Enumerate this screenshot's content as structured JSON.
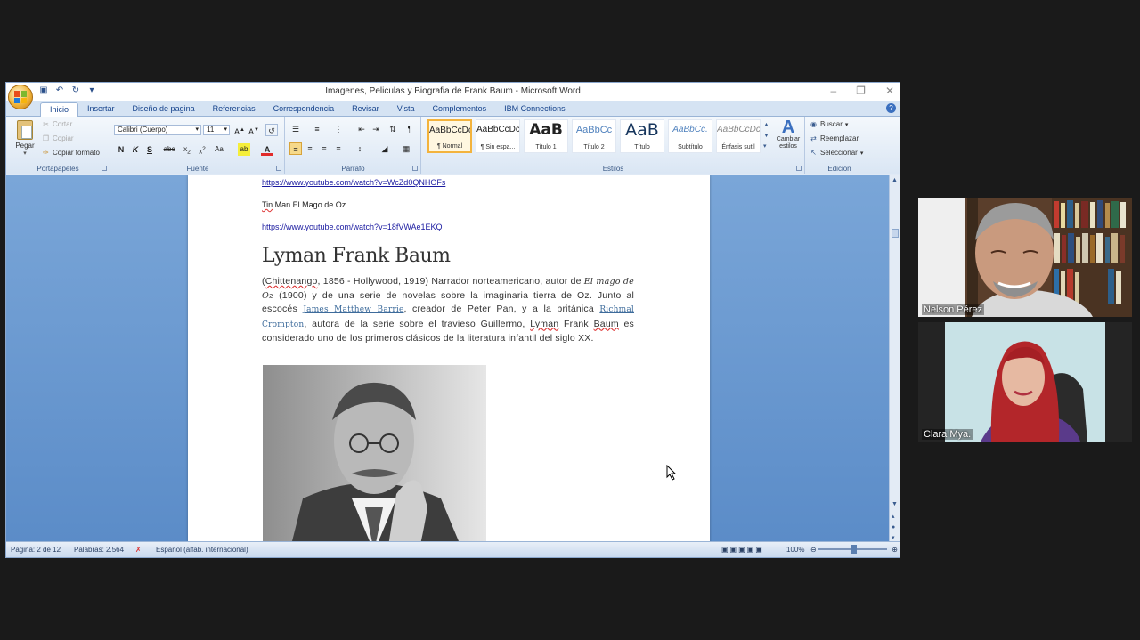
{
  "window": {
    "title": "Imagenes, Peliculas y Biografia de Frank Baum - Microsoft Word"
  },
  "tabs": [
    "Inicio",
    "Insertar",
    "Diseño de pagina",
    "Referencias",
    "Correspondencia",
    "Revisar",
    "Vista",
    "Complementos",
    "IBM Connections"
  ],
  "clipboard": {
    "paste_label": "Pegar",
    "cut_label": "Cortar",
    "copy_label": "Copiar",
    "format_painter_label": "Copiar formato",
    "group_label": "Portapapeles"
  },
  "font": {
    "font_name": "Calibri (Cuerpo)",
    "font_size": "11",
    "group_label": "Fuente"
  },
  "paragraph": {
    "group_label": "Párrafo"
  },
  "styles": {
    "group_label": "Estilos",
    "items": [
      {
        "sample": "AaBbCcDc",
        "name": "¶ Normal"
      },
      {
        "sample": "AaBbCcDc",
        "name": "¶ Sin espa..."
      },
      {
        "sample": "AaB",
        "name": "Título 1"
      },
      {
        "sample": "AaBbCc",
        "name": "Título 2"
      },
      {
        "sample": "AaB",
        "name": "Título"
      },
      {
        "sample": "AaBbCc.",
        "name": "Subtítulo"
      },
      {
        "sample": "AaBbCcDc",
        "name": "Énfasis sutil"
      }
    ],
    "change_styles_label": "Cambiar estilos"
  },
  "editing": {
    "find_label": "Buscar",
    "replace_label": "Reemplazar",
    "select_label": "Seleccionar",
    "group_label": "Edición"
  },
  "document": {
    "link1": "https://www.youtube.com/watch?v=WcZd0QNHOFs",
    "line2_word1": "Tin",
    "line2_rest": " Man El Mago de Oz",
    "link2": "https://www.youtube.com/watch?v=18fVWAe1EKQ",
    "heading": "Lyman Frank Baum",
    "para_1": "(",
    "para_chittenango": "Chittenango",
    "para_2": ", 1856 - Hollywood, 1919) Narrador norteamericano, autor de ",
    "para_book": "El mago de Oz",
    "para_3": " (1900) y de una serie de novelas sobre la imaginaria tierra de Oz. Junto al escocés ",
    "para_link1": "James Matthew Barrie",
    "para_4": ", creador de Peter Pan, y a la británica ",
    "para_link2": "Richmal Crompton",
    "para_5": ", autora de la serie sobre el travieso Guillermo, ",
    "para_lyman": "Lyman",
    "para_6": " Frank ",
    "para_baum": "Baum",
    "para_7": " es considerado uno de los primeros clásicos de la literatura infantil del siglo XX."
  },
  "status": {
    "page": "Página: 2 de 12",
    "words": "Palabras: 2.564",
    "language": "Español (alfab. internacional)",
    "zoom": "100%"
  },
  "participants": [
    {
      "name": "Nelson Pérez"
    },
    {
      "name": "Clara Mya."
    }
  ]
}
